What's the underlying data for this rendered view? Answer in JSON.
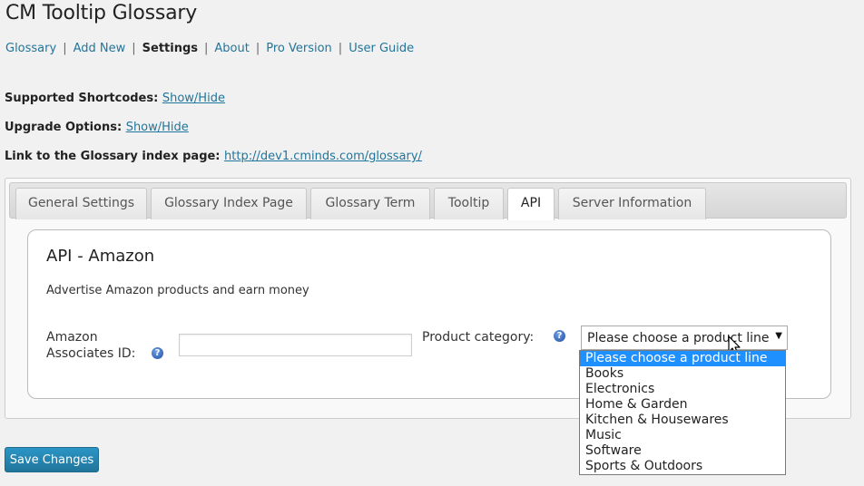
{
  "page": {
    "title": "CM Tooltip Glossary"
  },
  "subnav": {
    "items": [
      {
        "label": "Glossary"
      },
      {
        "label": "Add New"
      },
      {
        "label": "Settings"
      },
      {
        "label": "About"
      },
      {
        "label": "Pro Version"
      },
      {
        "label": "User Guide"
      }
    ],
    "separator": "|",
    "current_index": 2
  },
  "info": {
    "shortcodes": {
      "label": "Supported Shortcodes:",
      "link": "Show/Hide"
    },
    "upgrade": {
      "label": "Upgrade Options:",
      "link": "Show/Hide"
    },
    "index_page": {
      "label": "Link to the Glossary index page:",
      "link": "http://dev1.cminds.com/glossary/"
    }
  },
  "tabs": [
    {
      "label": "General Settings"
    },
    {
      "label": "Glossary Index Page"
    },
    {
      "label": "Glossary Term"
    },
    {
      "label": "Tooltip"
    },
    {
      "label": "API"
    },
    {
      "label": "Server Information"
    }
  ],
  "active_tab_index": 4,
  "panel": {
    "title": "API - Amazon",
    "description": "Advertise Amazon products and earn money",
    "associates_label_line1": "Amazon",
    "associates_label_line2": "Associates ID:",
    "associates_value": "",
    "category_label": "Product category:",
    "help_glyph": "?",
    "select": {
      "selected": "Please choose a product line",
      "arrow": "▼",
      "options": [
        "Please choose a product line",
        "Books",
        "Electronics",
        "Home & Garden",
        "Kitchen & Housewares",
        "Music",
        "Software",
        "Sports & Outdoors"
      ],
      "highlighted_index": 0
    }
  },
  "save_label": "Save Changes",
  "colors": {
    "link": "#21759b",
    "button": "#21759b",
    "highlight": "#1e90ff",
    "help_icon": "#2b5fb8"
  },
  "icons": {
    "help": "help-icon",
    "cursor": "mouse-pointer-icon"
  }
}
